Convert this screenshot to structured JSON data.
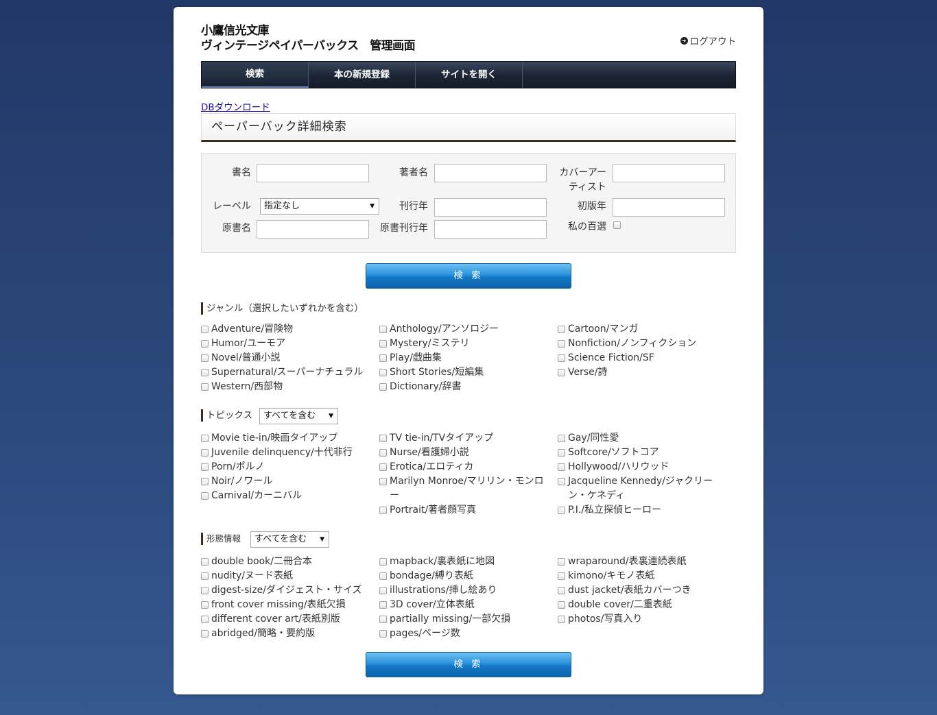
{
  "header": {
    "title_line1": "小鷹信光文庫",
    "title_line2": "ヴィンテージペイパーバックス　管理画面",
    "logout": "ログアウト"
  },
  "nav": [
    "検索",
    "本の新規登録",
    "サイトを開く"
  ],
  "db_download": "DBダウンロード",
  "section_title": "ペーパーバック詳細検索",
  "form": {
    "title_label": "書名",
    "author_label": "著者名",
    "cover_artist_label_1": "カバーアー",
    "cover_artist_label_2": "ティスト",
    "label_label": "レーベル",
    "label_value": "指定なし",
    "pub_year_label": "刊行年",
    "first_ed_label": "初版年",
    "orig_title_label": "原書名",
    "orig_pub_year_label": "原書刊行年",
    "my100_label": "私の百選"
  },
  "search_button": "検 索",
  "genre": {
    "heading": "ジャンル（選択したいずれかを含む）",
    "columns": [
      [
        "Adventure/冒険物",
        "Humor/ユーモア",
        "Novel/普通小説",
        "Supernatural/スーパーナチュラル",
        "Western/西部物"
      ],
      [
        "Anthology/アンソロジー",
        "Mystery/ミステリ",
        "Play/戯曲集",
        "Short Stories/短編集",
        "Dictionary/辞書"
      ],
      [
        "Cartoon/マンガ",
        "Nonfiction/ノンフィクション",
        "Science Fiction/SF",
        "Verse/詩"
      ]
    ]
  },
  "topics": {
    "heading": "トピックス",
    "select_value": "すべてを含む",
    "columns": [
      [
        "Movie tie-in/映画タイアップ",
        "Juvenile delinquency/十代非行",
        "Porn/ポルノ",
        "Noir/ノワール",
        "Carnival/カーニバル"
      ],
      [
        "TV tie-in/TVタイアップ",
        "Nurse/看護婦小説",
        "Erotica/エロティカ",
        "Marilyn Monroe/マリリン・モンロー",
        "Portrait/著者顔写真"
      ],
      [
        "Gay/同性愛",
        "Softcore/ソフトコア",
        "Hollywood/ハリウッド",
        "Jacqueline Kennedy/ジャクリーン・ケネディ",
        "P.I./私立探偵ヒーロー"
      ]
    ]
  },
  "format": {
    "heading": "形態情報",
    "select_value": "すべてを含む",
    "columns": [
      [
        "double book/二冊合本",
        "nudity/ヌード表紙",
        "digest-size/ダイジェスト・サイズ",
        "front cover missing/表紙欠損",
        "different cover art/表紙別版",
        "abridged/簡略・要約版"
      ],
      [
        "mapback/裏表紙に地図",
        "bondage/縛り表紙",
        "illustrations/挿し絵あり",
        "3D cover/立体表紙",
        "partially missing/一部欠損",
        "pages/ページ数"
      ],
      [
        "wraparound/表裏連続表紙",
        "kimono/キモノ表紙",
        "dust jacket/表紙カバーつき",
        "double cover/二重表紙",
        "photos/写真入り"
      ]
    ]
  }
}
